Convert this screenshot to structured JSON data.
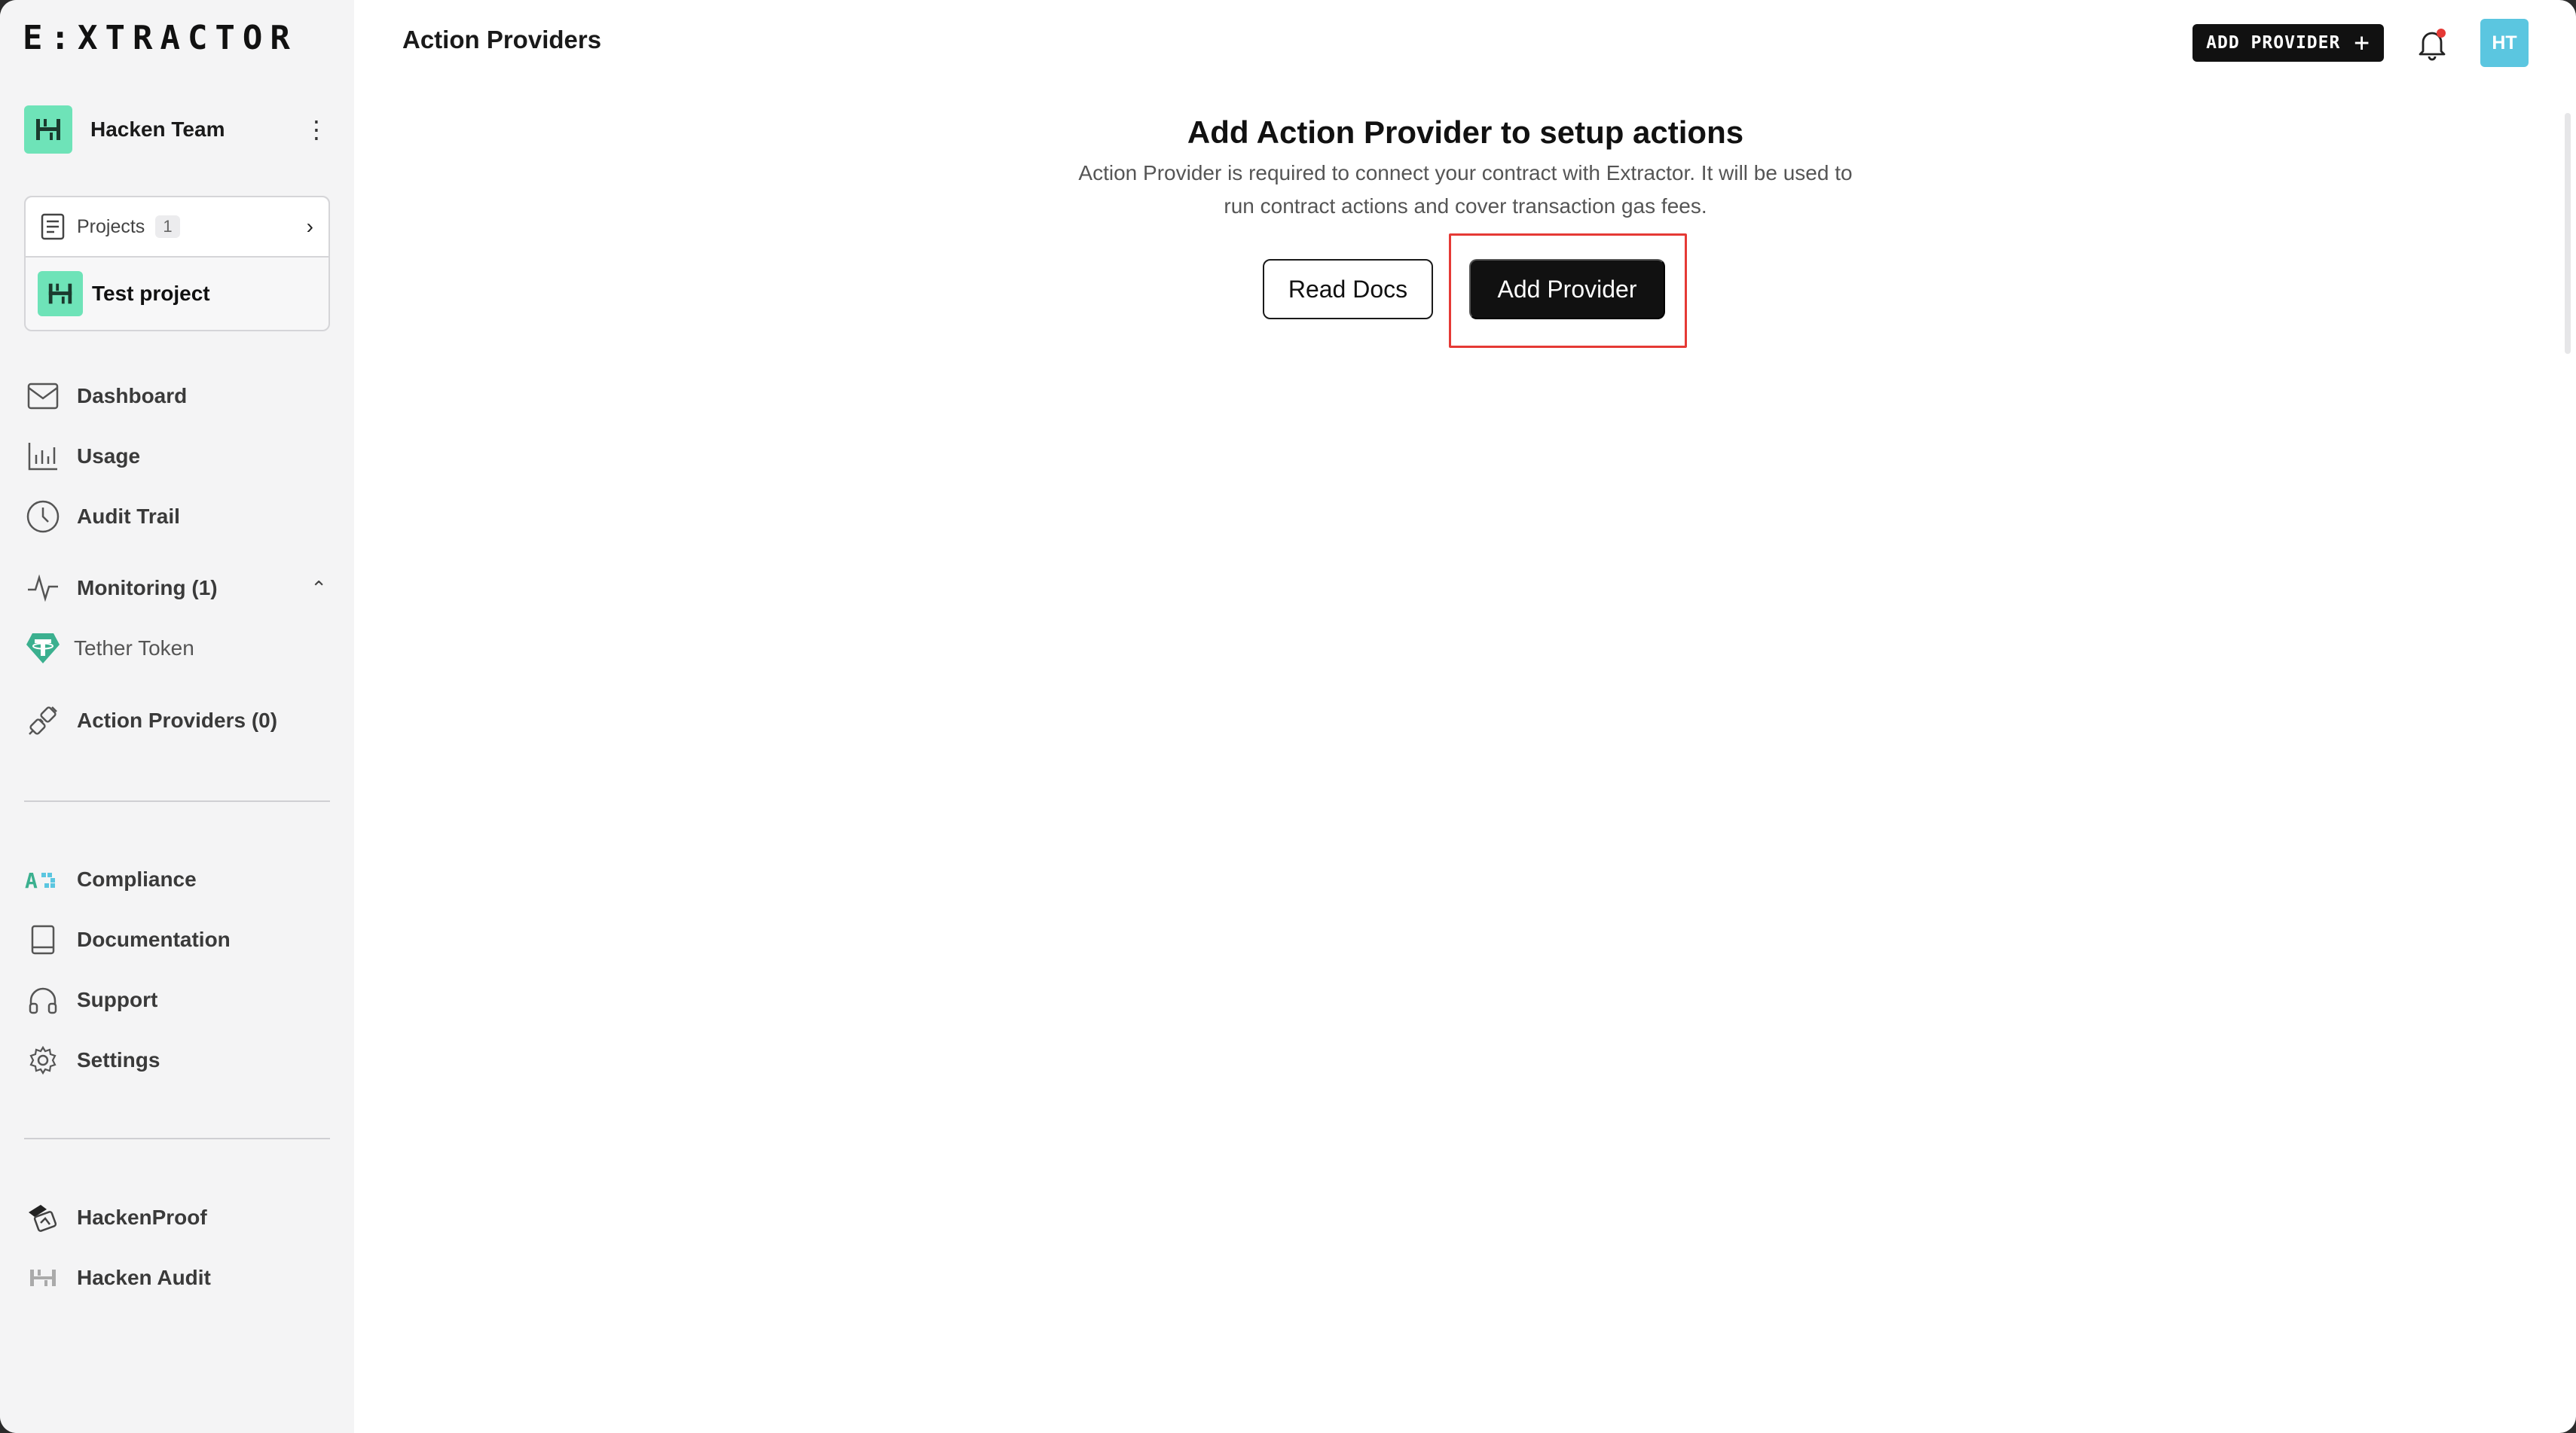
{
  "app": {
    "logo_text": "E:XTRACTOR"
  },
  "sidebar": {
    "team_name": "Hacken Team",
    "projects_label": "Projects",
    "projects_count": "1",
    "project_name": "Test project",
    "nav_main": [
      {
        "label": "Dashboard",
        "icon": "dashboard-icon"
      },
      {
        "label": "Usage",
        "icon": "bar-chart-icon"
      },
      {
        "label": "Audit Trail",
        "icon": "clock-icon"
      }
    ],
    "monitoring_label": "Monitoring (1)",
    "monitoring_items": [
      {
        "label": "Tether Token",
        "icon": "tether-icon"
      }
    ],
    "action_providers_label": "Action Providers (0)",
    "nav_secondary": [
      {
        "label": "Compliance",
        "icon": "compliance-icon"
      },
      {
        "label": "Documentation",
        "icon": "book-icon"
      },
      {
        "label": "Support",
        "icon": "headphones-icon"
      },
      {
        "label": "Settings",
        "icon": "gear-icon"
      }
    ],
    "nav_external": [
      {
        "label": "HackenProof",
        "icon": "hackenproof-icon"
      },
      {
        "label": "Hacken Audit",
        "icon": "hacken-audit-icon"
      }
    ]
  },
  "header": {
    "title": "Action Providers",
    "add_provider_label": "ADD PROVIDER",
    "avatar_initials": "HT"
  },
  "empty_state": {
    "title": "Add Action Provider to setup actions",
    "description": "Action Provider is required to connect your contract with Extractor. It will be used to run contract actions and cover transaction gas fees.",
    "read_docs_label": "Read Docs",
    "add_provider_label": "Add Provider"
  },
  "colors": {
    "accent_green": "#6ee3b8",
    "avatar_blue": "#5bc6e0",
    "highlight_red": "#e53935",
    "primary_dark": "#111111"
  }
}
